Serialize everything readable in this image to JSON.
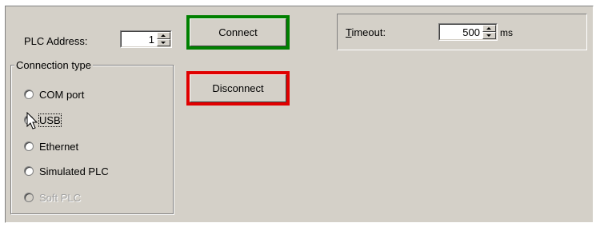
{
  "plc_address": {
    "label": "PLC Address:",
    "value": "1"
  },
  "connection_type": {
    "title": "Connection type",
    "options": [
      {
        "label": "COM port",
        "selected": false,
        "enabled": true
      },
      {
        "label": "USB",
        "selected": true,
        "enabled": true
      },
      {
        "label": "Ethernet",
        "selected": false,
        "enabled": true
      },
      {
        "label": "Simulated PLC",
        "selected": false,
        "enabled": true
      },
      {
        "label": "Soft PLC",
        "selected": false,
        "enabled": false
      }
    ]
  },
  "buttons": {
    "connect": {
      "label": "Connect",
      "highlight": "#008000"
    },
    "disconnect": {
      "label": "Disconnect",
      "highlight": "#e00000"
    }
  },
  "timeout": {
    "label_access_key": "T",
    "label_rest": "imeout:",
    "value": "500",
    "unit": "ms"
  }
}
